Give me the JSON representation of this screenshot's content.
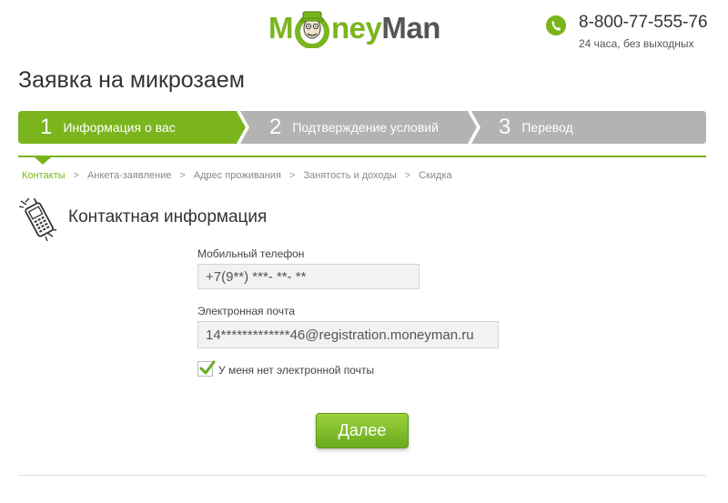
{
  "header": {
    "logo": {
      "part1": "M",
      "part2": "ney",
      "part3": "Man"
    },
    "phone_number": "8-800-77-555-76",
    "phone_hours": "24 часа, без выходных",
    "brand_color": "#7ab51d",
    "icons": {
      "phone": "phone-icon",
      "logo_mascot": "mascot-icon"
    }
  },
  "page_title": "Заявка на микрозаем",
  "steps": [
    {
      "number": "1",
      "label": "Информация о вас",
      "active": true
    },
    {
      "number": "2",
      "label": "Подтверждение условий",
      "active": false
    },
    {
      "number": "3",
      "label": "Перевод",
      "active": false
    }
  ],
  "substeps": {
    "items": [
      "Контакты",
      "Анкета-заявление",
      "Адрес проживания",
      "Занятость и доходы",
      "Скидка"
    ],
    "separator": ">",
    "active_index": 0
  },
  "section": {
    "title": "Контактная информация",
    "icon": "mobile-phone-icon"
  },
  "form": {
    "phone_label": "Мобильный телефон",
    "phone_value": "+7(9**) ***- **- **",
    "email_label": "Электронная почта",
    "email_value": "14*************46@registration.moneyman.ru",
    "no_email_checked": true,
    "no_email_label": "У меня нет электронной почты",
    "submit_label": "Далее"
  }
}
